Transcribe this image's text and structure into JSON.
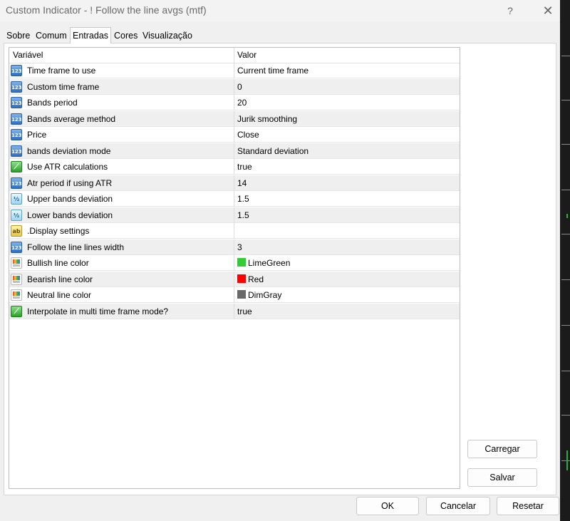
{
  "window": {
    "title": "Custom Indicator - ! Follow the line avgs (mtf)",
    "help_glyph": "?",
    "close_glyph": "✕"
  },
  "tabs": [
    {
      "label": "Sobre"
    },
    {
      "label": "Comum"
    },
    {
      "label": "Entradas"
    },
    {
      "label": "Cores"
    },
    {
      "label": "Visualização"
    }
  ],
  "active_tab": "Entradas",
  "grid": {
    "col_variable": "Variável",
    "col_value": "Valor",
    "rows": [
      {
        "icon": "number-type-icon",
        "glyph": "123",
        "name": "Time frame to use",
        "value": "Current time frame"
      },
      {
        "icon": "number-type-icon",
        "glyph": "123",
        "name": "Custom time frame",
        "value": "0"
      },
      {
        "icon": "number-type-icon",
        "glyph": "123",
        "name": "Bands period",
        "value": "20"
      },
      {
        "icon": "number-type-icon",
        "glyph": "123",
        "name": "Bands average method",
        "value": "Jurik smoothing"
      },
      {
        "icon": "number-type-icon",
        "glyph": "123",
        "name": "Price",
        "value": "Close"
      },
      {
        "icon": "number-type-icon",
        "glyph": "123",
        "name": "bands deviation mode",
        "value": "Standard deviation"
      },
      {
        "icon": "boolean-type-icon",
        "glyph": "⟋",
        "name": "Use ATR calculations",
        "value": "true"
      },
      {
        "icon": "number-type-icon",
        "glyph": "123",
        "name": "Atr period if using ATR",
        "value": "14"
      },
      {
        "icon": "double-type-icon",
        "glyph": "½",
        "name": "Upper bands deviation",
        "value": "1.5"
      },
      {
        "icon": "double-type-icon",
        "glyph": "½",
        "name": "Lower bands deviation",
        "value": "1.5"
      },
      {
        "icon": "string-type-icon",
        "glyph": "ab",
        "name": ".Display settings",
        "value": ""
      },
      {
        "icon": "number-type-icon",
        "glyph": "123",
        "name": "Follow the line lines width",
        "value": "3"
      },
      {
        "icon": "color-type-icon",
        "glyph": "",
        "name": "Bullish line color",
        "value": "LimeGreen",
        "swatch": "#32cd32"
      },
      {
        "icon": "color-type-icon",
        "glyph": "",
        "name": "Bearish line color",
        "value": "Red",
        "swatch": "#ff0000"
      },
      {
        "icon": "color-type-icon",
        "glyph": "",
        "name": "Neutral line color",
        "value": "DimGray",
        "swatch": "#696969"
      },
      {
        "icon": "boolean-type-icon",
        "glyph": "⟋",
        "name": "Interpolate in multi time frame mode?",
        "value": "true"
      }
    ]
  },
  "buttons": {
    "load": "Carregar",
    "save": "Salvar",
    "ok": "OK",
    "cancel": "Cancelar",
    "reset": "Resetar"
  }
}
